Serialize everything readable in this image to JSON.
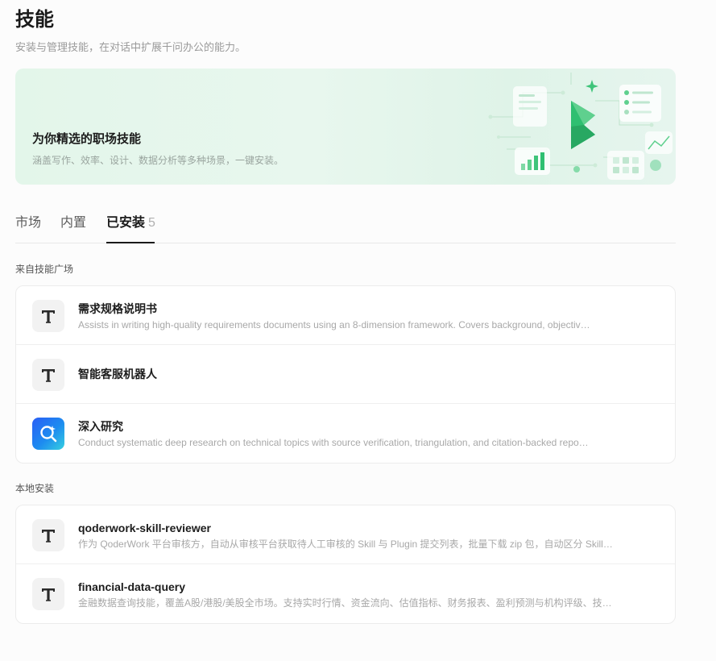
{
  "header": {
    "title": "技能",
    "subtitle": "安装与管理技能，在对话中扩展千问办公的能力。"
  },
  "banner": {
    "title": "为你精选的职场技能",
    "description": "涵盖写作、效率、设计、数据分析等多种场景，一键安装。"
  },
  "tabs": [
    {
      "label": "市场"
    },
    {
      "label": "内置"
    },
    {
      "label": "已安装",
      "count": "5"
    }
  ],
  "sections": {
    "marketplace": {
      "label": "来自技能广场",
      "items": [
        {
          "name": "需求规格说明书",
          "description": "Assists in writing high-quality requirements documents using an 8-dimension framework. Covers background, objectiv…",
          "icon": "skill-t-icon"
        },
        {
          "name": "智能客服机器人",
          "description": "",
          "icon": "skill-t-icon"
        },
        {
          "name": "深入研究",
          "description": "Conduct systematic deep research on technical topics with source verification, triangulation, and citation-backed repo…",
          "icon": "research-icon"
        }
      ]
    },
    "local": {
      "label": "本地安装",
      "items": [
        {
          "name": "qoderwork-skill-reviewer",
          "description": "作为 QoderWork 平台审核方，自动从审核平台获取待人工审核的 Skill 与 Plugin 提交列表，批量下载 zip 包，自动区分 Skill…",
          "icon": "skill-t-icon"
        },
        {
          "name": "financial-data-query",
          "description": "金融数据查询技能，覆盖A股/港股/美股全市场。支持实时行情、资金流向、估值指标、财务报表、盈利预测与机构评级、技…",
          "icon": "skill-t-icon"
        }
      ]
    }
  },
  "colors": {
    "brand_green": "#2fbf71",
    "research_blue": "#2b5ef5"
  }
}
